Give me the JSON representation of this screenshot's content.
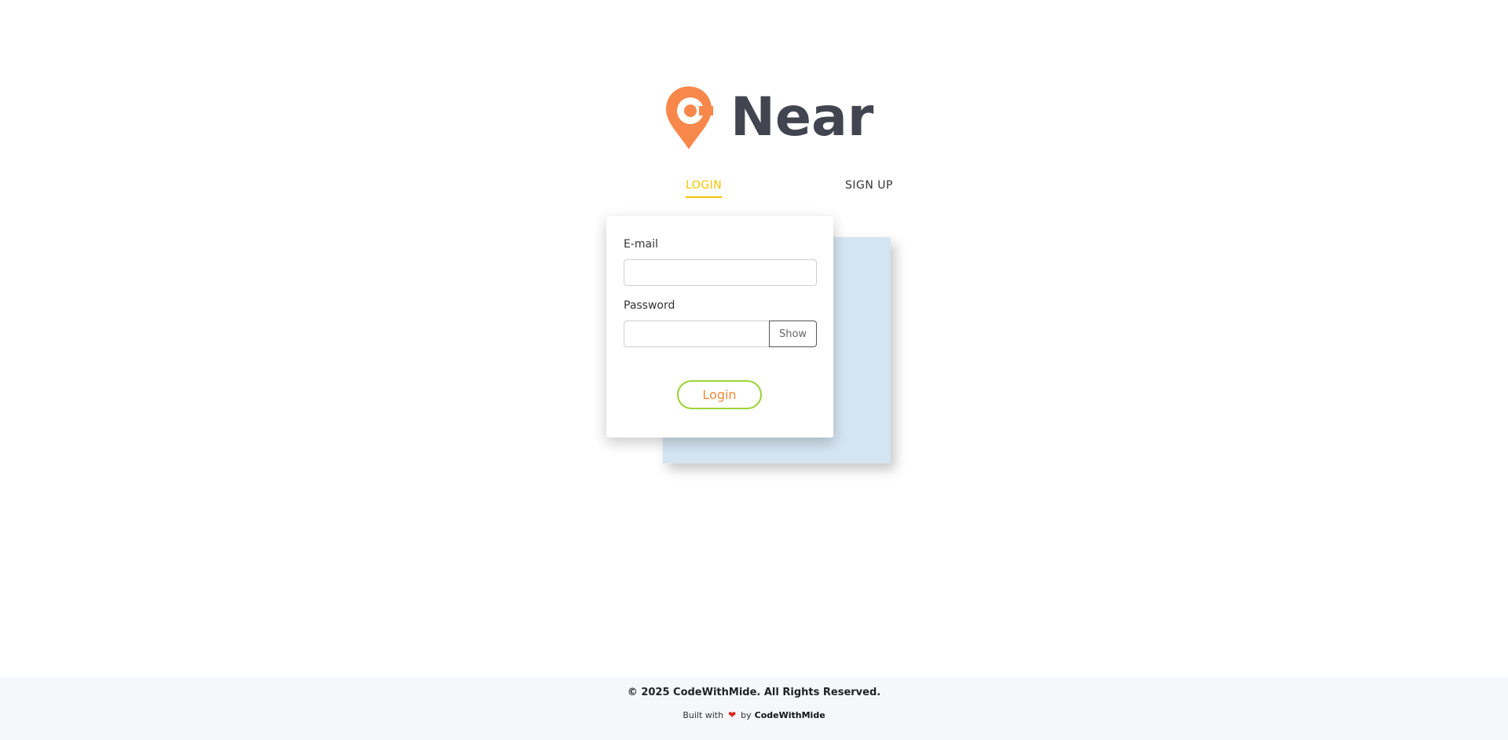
{
  "brand": {
    "name": "Near",
    "icon": "location-pin-logo-icon",
    "icon_color": "#f7874a",
    "text_color": "#424450"
  },
  "tabs": [
    {
      "label": "LOGIN",
      "active": true
    },
    {
      "label": "SIGN UP",
      "active": false
    }
  ],
  "tab_active_color": "#f5c400",
  "form": {
    "email_label": "E-mail",
    "email_value": "",
    "email_placeholder": "",
    "password_label": "Password",
    "password_value": "",
    "password_placeholder": "",
    "show_label": "Show",
    "submit_label": "Login",
    "submit_border_color": "#9bd435",
    "submit_text_color": "#f0883a"
  },
  "footer": {
    "copyright": "© 2025 CodeWithMide. All Rights Reserved.",
    "built_prefix": "Built with",
    "heart_icon": "heart-icon",
    "built_by": "by",
    "built_by_name": "CodeWithMide"
  }
}
